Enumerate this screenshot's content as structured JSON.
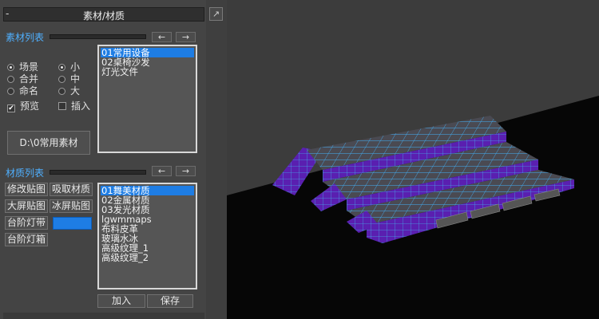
{
  "panel": {
    "title": "素材/材质",
    "collapse_glyph": "-",
    "pin_glyph": "↗"
  },
  "assets": {
    "section_label": "素材列表",
    "prev_label": "←",
    "next_label": "→",
    "scope_options": [
      "场景",
      "合并",
      "命名"
    ],
    "scope_selected": "场景",
    "size_options": [
      "小",
      "中",
      "大"
    ],
    "size_selected": "小",
    "preview_label": "预览",
    "preview_checked": true,
    "insert_label": "插入",
    "insert_checked": false,
    "items": [
      "01常用设备",
      "02桌椅沙发",
      "灯光文件"
    ],
    "selected_index": 0,
    "path_button": "D:\\0常用素材"
  },
  "materials": {
    "section_label": "材质列表",
    "prev_label": "←",
    "next_label": "→",
    "buttons": [
      "修改贴图",
      "吸取材质",
      "大屏贴图",
      "冰屏贴图",
      "台阶灯带",
      "台阶灯箱"
    ],
    "swatch_color": "#1e7de4",
    "items": [
      "01舞美材质",
      "02金属材质",
      "03发光材质",
      "lgwmmaps",
      "布料皮革",
      "玻璃水冰",
      "高级纹理_1",
      "高级纹理_2"
    ],
    "selected_index": 0,
    "add_label": "加入",
    "save_label": "保存"
  },
  "viewport": {
    "background": "#3c3c3c",
    "floor": "#060606",
    "model_color": "#5a1fb0",
    "wire_color": "#43a8e8"
  }
}
